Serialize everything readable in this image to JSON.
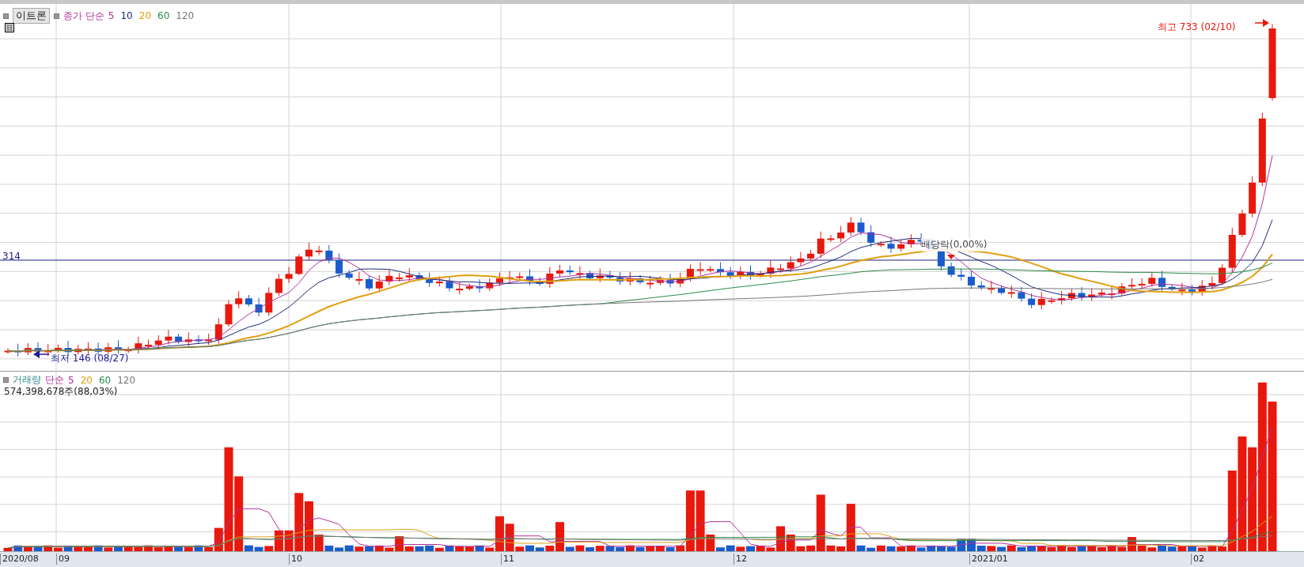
{
  "toolbar": {
    "stock_name": "이트론",
    "indicator_label": "종가 단순",
    "ma_legend": [
      {
        "label": "5",
        "color": "#b0309a"
      },
      {
        "label": "10",
        "color": "#1c2a78"
      },
      {
        "label": "20",
        "color": "#e0a010"
      },
      {
        "label": "60",
        "color": "#2a8a48"
      },
      {
        "label": "120",
        "color": "#777777"
      }
    ]
  },
  "price_panel": {
    "reference_line_label": "314",
    "high_marker": "최고 733 (02/10)",
    "low_marker": "최저 146 (08/27)",
    "event_marker": "배당락(0,00%)"
  },
  "volume_panel": {
    "indicator_label": "거래량",
    "ma_type_label": "단순",
    "ma_legend": [
      {
        "label": "5",
        "color": "#b0309a"
      },
      {
        "label": "20",
        "color": "#e0a010"
      },
      {
        "label": "60",
        "color": "#2a8a48"
      },
      {
        "label": "120",
        "color": "#777777"
      }
    ],
    "total_volume": "574,398,678주(88,03%)"
  },
  "x_axis": {
    "labels": [
      "2020/08",
      "09",
      "10",
      "11",
      "12",
      "2021/01",
      "02"
    ]
  }
}
